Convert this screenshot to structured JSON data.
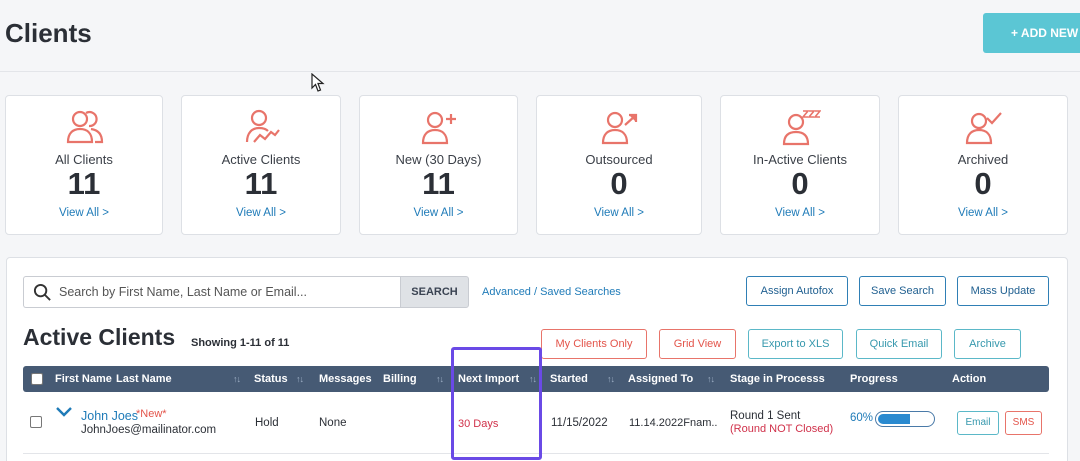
{
  "header": {
    "title": "Clients",
    "add_button": "+ ADD NEW L"
  },
  "cards": [
    {
      "label": "All Clients",
      "count": "11",
      "link": "View All >",
      "icon": "users-icon"
    },
    {
      "label": "Active Clients",
      "count": "11",
      "link": "View All >",
      "icon": "user-activity-icon"
    },
    {
      "label": "New (30 Days)",
      "count": "11",
      "link": "View All >",
      "icon": "user-plus-icon"
    },
    {
      "label": "Outsourced",
      "count": "0",
      "link": "View All >",
      "icon": "user-outsource-icon"
    },
    {
      "label": "In-Active Clients",
      "count": "0",
      "link": "View All >",
      "icon": "user-sleep-icon"
    },
    {
      "label": "Archived",
      "count": "0",
      "link": "View All >",
      "icon": "user-check-icon"
    }
  ],
  "search": {
    "placeholder": "Search by First Name, Last Name or Email...",
    "button": "SEARCH",
    "advanced_link": "Advanced / Saved Searches"
  },
  "actions_top": [
    "Assign Autofox",
    "Save Search",
    "Mass Update"
  ],
  "section": {
    "title": "Active Clients",
    "showing": "Showing 1-11 of 11"
  },
  "actions_mid": [
    "My Clients Only",
    "Grid View",
    "Export to XLS",
    "Quick Email",
    "Archive"
  ],
  "table": {
    "columns": [
      "First Name",
      "Last Name",
      "Status",
      "Messages",
      "Billing",
      "Next Import",
      "Started",
      "Assigned To",
      "Stage in Processs",
      "Progress",
      "Action"
    ],
    "rows": [
      {
        "name": "John Joes",
        "badge": "*New*",
        "email": "JohnJoes@mailinator.com",
        "status": "Hold",
        "messages": "None",
        "next_import": "30 Days",
        "started": "11/15/2022",
        "assigned_to": "11.14.2022Fnam..",
        "stage": "Round 1 Sent",
        "stage_note": "(Round NOT Closed)",
        "progress": "60%",
        "progress_value": 0.6,
        "actions": [
          "Email",
          "SMS"
        ]
      }
    ]
  },
  "colors": {
    "accent": "#5bc6d4",
    "header_bg": "#465a74",
    "link": "#1f7bb8",
    "icon": "#e8746a",
    "highlight": "#6a4ae6"
  }
}
